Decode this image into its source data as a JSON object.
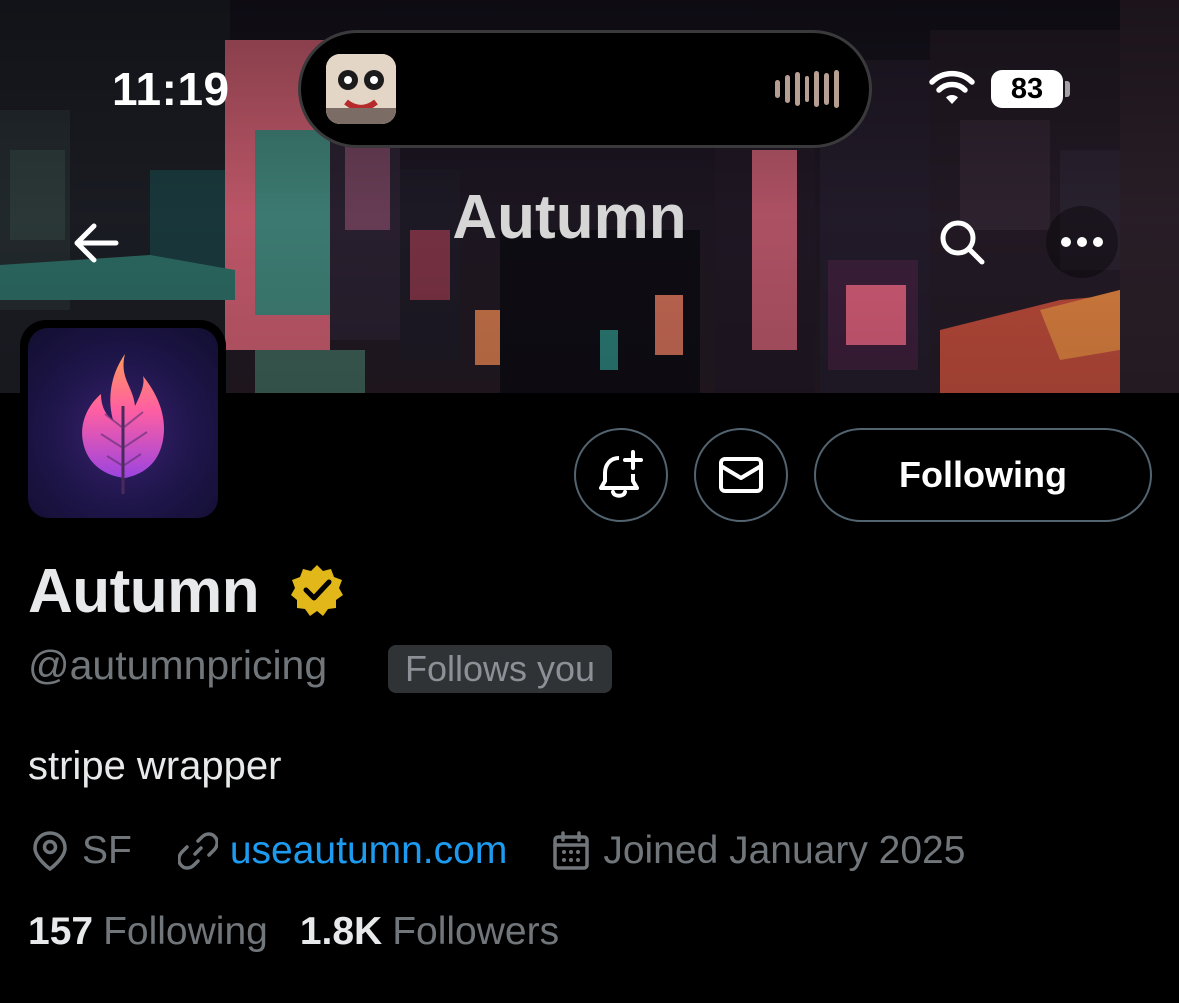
{
  "status_bar": {
    "time": "11:19",
    "battery": "83"
  },
  "header": {
    "title": "Autumn",
    "back_icon": "arrow-left-icon",
    "search_icon": "search-icon",
    "more_icon": "more-horizontal-icon"
  },
  "profile": {
    "display_name": "Autumn",
    "verified_icon": "verified-badge-icon",
    "verified_color": "#e2b719",
    "handle": "@autumnpricing",
    "follows_you": "Follows you",
    "bio": "stripe wrapper",
    "location": "SF",
    "website": "useautumn.com",
    "joined": "Joined January 2025",
    "following_count": "157",
    "following_label": "Following",
    "followers_count": "1.8K",
    "followers_label": "Followers"
  },
  "actions": {
    "notify_icon": "bell-plus-icon",
    "message_icon": "mail-icon",
    "following_button": "Following"
  },
  "colors": {
    "background": "#000000",
    "link": "#1d9bf0",
    "muted_text": "#71767b",
    "button_border": "#536471"
  }
}
